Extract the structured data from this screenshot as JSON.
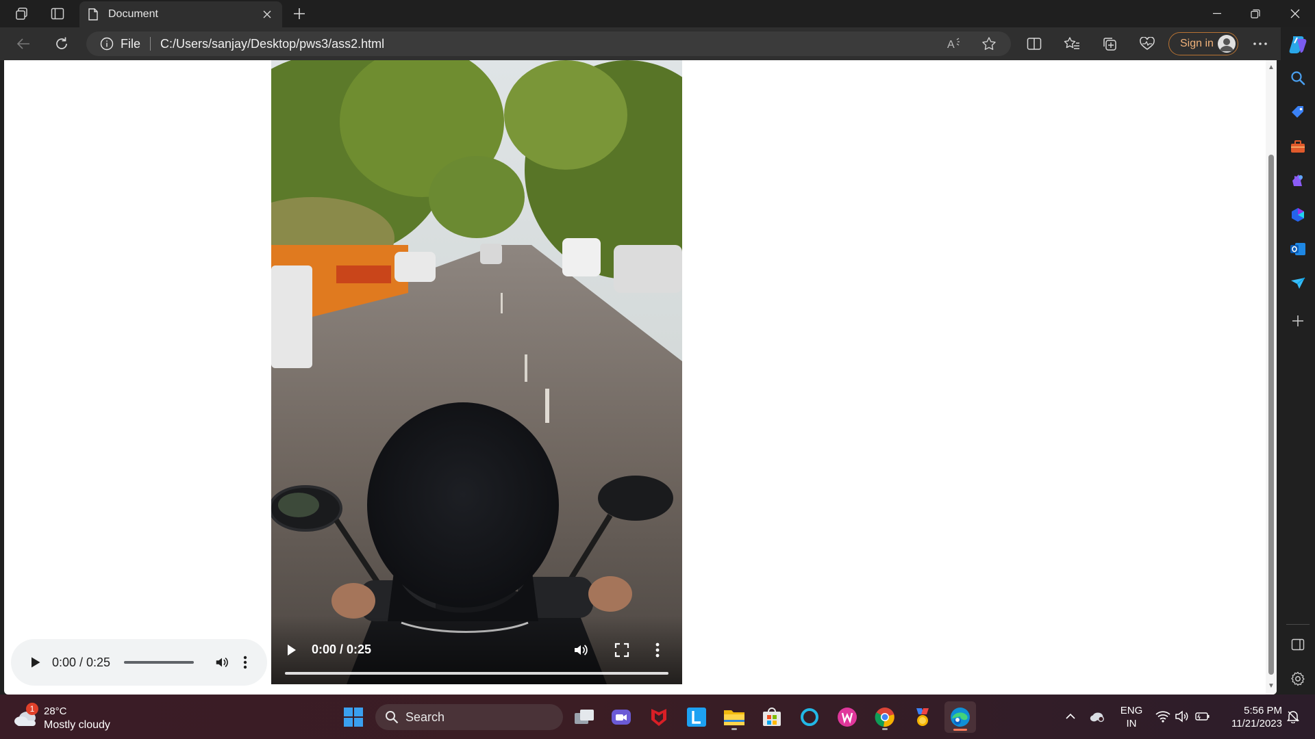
{
  "browser": {
    "tab_title": "Document",
    "address_scheme": "File",
    "address_url": "C:/Users/sanjay/Desktop/pws3/ass2.html",
    "signin_label": "Sign in"
  },
  "page": {
    "audio": {
      "time": "0:00 / 0:25"
    },
    "video": {
      "time": "0:00 / 0:25"
    }
  },
  "taskbar": {
    "weather": {
      "badge": "1",
      "temp": "28°C",
      "condition": "Mostly cloudy"
    },
    "search_label": "Search",
    "language": {
      "line1": "ENG",
      "line2": "IN"
    },
    "clock": {
      "time": "5:56 PM",
      "date": "11/21/2023"
    }
  }
}
